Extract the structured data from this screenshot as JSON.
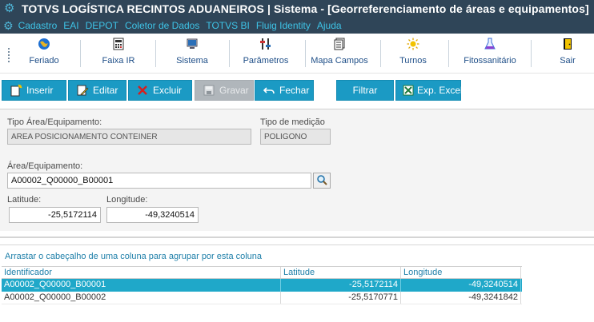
{
  "window": {
    "title": "TOTVS LOGÍSTICA RECINTOS ADUANEIROS | Sistema - [Georreferenciamento de áreas e equipamentos]",
    "logo_icon": "gear-icon"
  },
  "menu": {
    "items": [
      "Cadastro",
      "EAI",
      "DEPOT",
      "Coletor de Dados",
      "TOTVS BI",
      "Fluig Identity",
      "Ajuda"
    ],
    "color": "#3ec3e6"
  },
  "toolbar": {
    "items": [
      {
        "label": "Feriado",
        "icon": "globe-icon"
      },
      {
        "label": "Faixa IR",
        "icon": "calculator-icon"
      },
      {
        "label": "Sistema",
        "icon": "computer-icon"
      },
      {
        "label": "Parâmetros",
        "icon": "parameters-icon"
      },
      {
        "label": "Mapa Campos",
        "icon": "documents-icon"
      },
      {
        "label": "Turnos",
        "icon": "sun-icon"
      },
      {
        "label": "Fitossanitário",
        "icon": "flask-icon"
      },
      {
        "label": "Sair",
        "icon": "exit-door-icon"
      }
    ]
  },
  "actions": {
    "insert": "Inserir",
    "edit": "Editar",
    "delete": "Excluir",
    "save": "Gravar",
    "close": "Fechar",
    "filter": "Filtrar",
    "export": "Exp. Excel",
    "accent": "#1b9ac4",
    "disabled_color": "#b0b6bb"
  },
  "form": {
    "tipo_area_label": "Tipo Área/Equipamento:",
    "tipo_area_value": "AREA POSICIONAMENTO CONTEINER",
    "tipo_medicao_label": "Tipo de medição",
    "tipo_medicao_value": "POLIGONO",
    "area_label": "Área/Equipamento:",
    "area_value": "A00002_Q00000_B00001",
    "latitude_label": "Latitude:",
    "latitude_value": "-25,5172114",
    "longitude_label": "Longitude:",
    "longitude_value": "-49,3240514"
  },
  "grid": {
    "group_hint": "Arrastar o cabeçalho de uma coluna para agrupar por esta coluna",
    "columns": [
      "Identificador",
      "Latitude",
      "Longitude"
    ],
    "rows": [
      {
        "id": "A00002_Q00000_B00001",
        "lat": "-25,5172114",
        "lon": "-49,3240514",
        "selected": true
      },
      {
        "id": "A00002_Q00000_B00002",
        "lat": "-25,5170771",
        "lon": "-49,3241842",
        "selected": false
      }
    ],
    "selected_color": "#1fa8c9"
  }
}
